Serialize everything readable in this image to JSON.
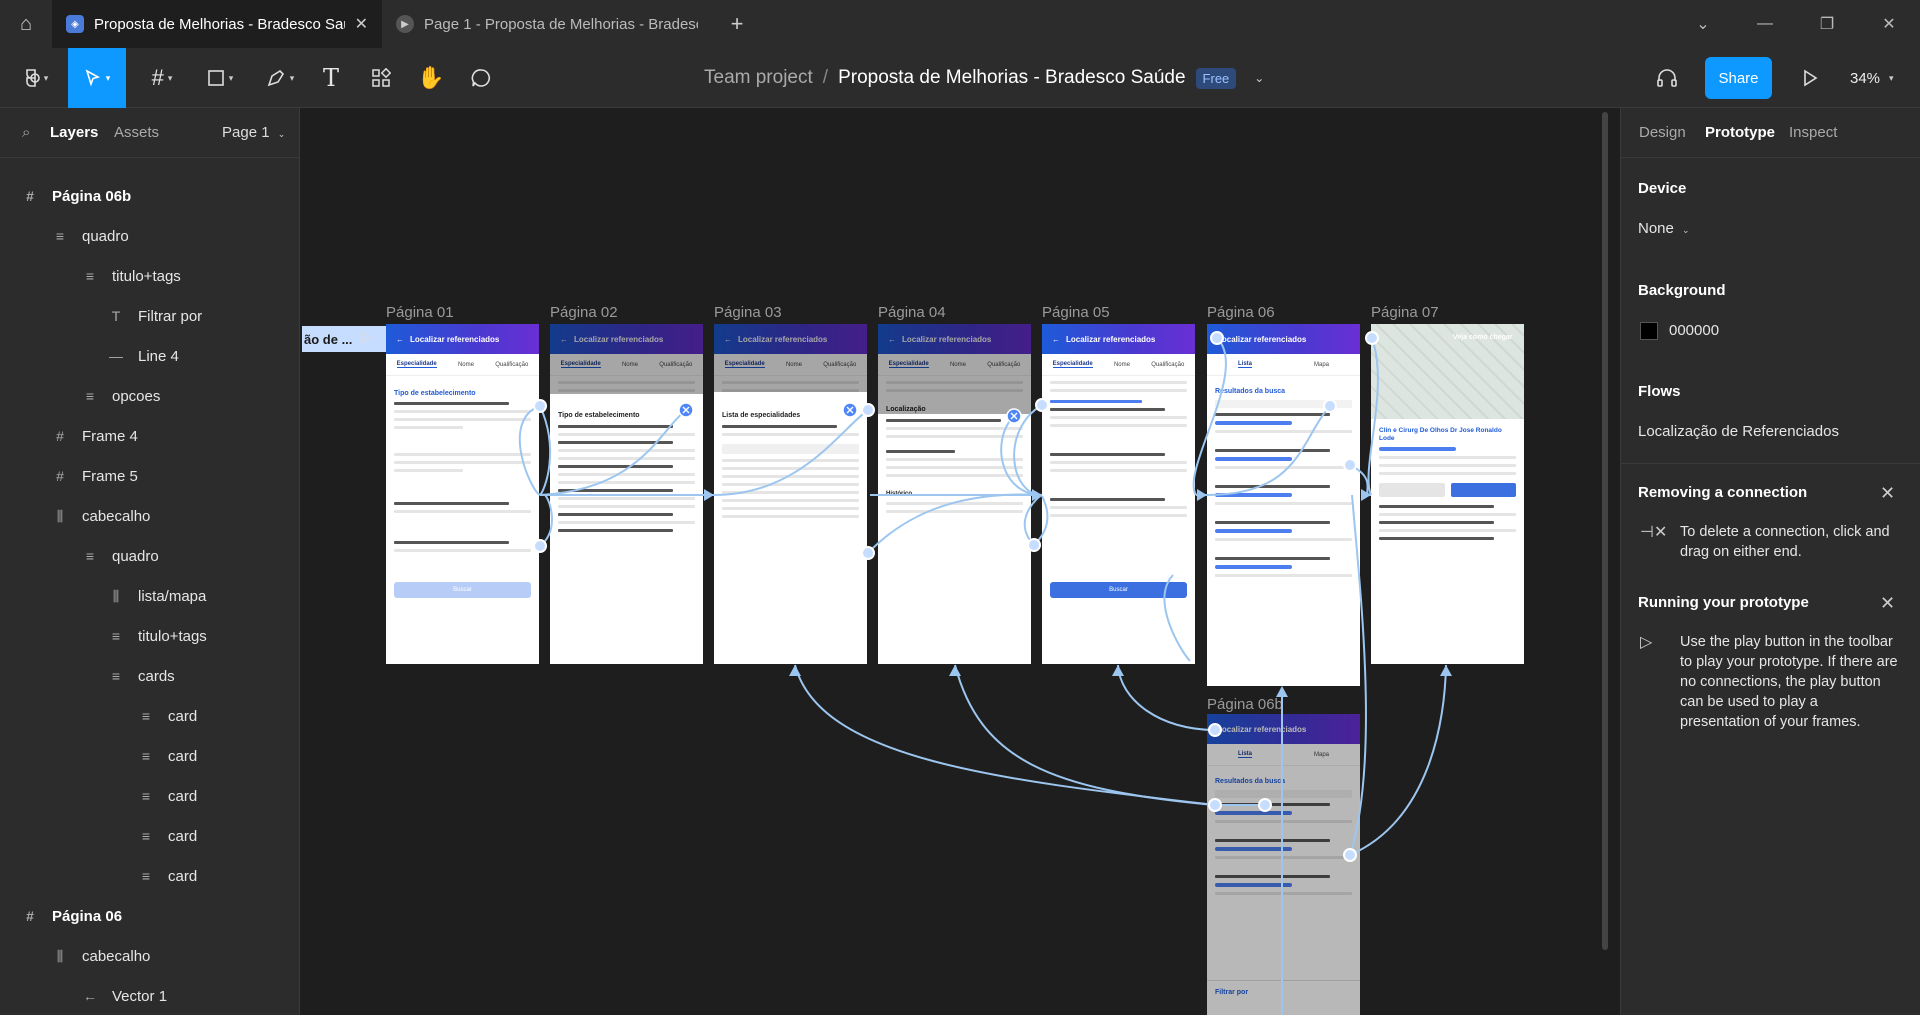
{
  "tabs": [
    {
      "label": "Proposta de Melhorias - Bradesco Saúde",
      "active": true
    },
    {
      "label": "Page 1 - Proposta de Melhorias - Bradesco",
      "active": false
    }
  ],
  "toolbar": {
    "team": "Team project",
    "separator": "/",
    "file_name": "Proposta de Melhorias - Bradesco Saúde",
    "plan_badge": "Free",
    "share_label": "Share",
    "zoom": "34%"
  },
  "left_panel": {
    "tab_layers": "Layers",
    "tab_assets": "Assets",
    "page": "Page 1",
    "layers": [
      {
        "name": "Página 06b",
        "icon": "frame-icon"
      },
      {
        "name": "quadro",
        "icon": "auto-layout-icon"
      },
      {
        "name": "titulo+tags",
        "icon": "auto-layout-icon"
      },
      {
        "name": "Filtrar por",
        "icon": "text-icon"
      },
      {
        "name": "Line 4",
        "icon": "line-icon"
      },
      {
        "name": "opcoes",
        "icon": "auto-layout-icon"
      },
      {
        "name": "Frame 4",
        "icon": "frame-icon"
      },
      {
        "name": "Frame 5",
        "icon": "frame-icon"
      },
      {
        "name": "cabecalho",
        "icon": "columns-icon"
      },
      {
        "name": "quadro",
        "icon": "auto-layout-icon"
      },
      {
        "name": "lista/mapa",
        "icon": "columns-icon"
      },
      {
        "name": "titulo+tags",
        "icon": "auto-layout-icon"
      },
      {
        "name": "cards",
        "icon": "auto-layout-icon"
      },
      {
        "name": "card",
        "icon": "auto-layout-icon"
      },
      {
        "name": "card",
        "icon": "auto-layout-icon"
      },
      {
        "name": "card",
        "icon": "auto-layout-icon"
      },
      {
        "name": "card",
        "icon": "auto-layout-icon"
      },
      {
        "name": "card",
        "icon": "auto-layout-icon"
      },
      {
        "name": "Página 06",
        "icon": "frame-icon"
      },
      {
        "name": "cabecalho",
        "icon": "columns-icon"
      },
      {
        "name": "Vector 1",
        "icon": "arrow-left-icon"
      }
    ]
  },
  "canvas": {
    "fragment_label": "ão de ...",
    "frames": [
      {
        "label": "Página 01",
        "header": "Localizar referenciados"
      },
      {
        "label": "Página 02",
        "header": "Localizar referenciados"
      },
      {
        "label": "Página 03",
        "header": "Localizar referenciados"
      },
      {
        "label": "Página 04",
        "header": "Localizar referenciados"
      },
      {
        "label": "Página 05",
        "header": "Localizar referenciados"
      },
      {
        "label": "Página 06",
        "header": "Localizar referenciados"
      },
      {
        "label": "Página 07",
        "header": "Veja como chegar"
      },
      {
        "label": "Página 06b",
        "header": "Localizar referenciados"
      }
    ],
    "screen_tabs": [
      "Especialidade",
      "Nome",
      "Qualificação"
    ],
    "list_tabs": [
      "Lista",
      "Mapa"
    ],
    "snippets": {
      "p01_section": "Tipo de estabelecimento",
      "p01_button": "Buscar",
      "p02_title": "Tipo de estabelecimento",
      "p03_title": "Lista de especialidades",
      "p04_title": "Localização",
      "p04_hist": "Histórico",
      "p05_button": "Buscar",
      "p06_results": "Resultados da busca",
      "p07_name": "Clin e Cirurg De Olhos Dr Jose Ronaldo Lode",
      "p06b_filter": "Filtrar por"
    }
  },
  "right_panel": {
    "tab_design": "Design",
    "tab_prototype": "Prototype",
    "tab_inspect": "Inspect",
    "device_heading": "Device",
    "device_value": "None",
    "background_heading": "Background",
    "background_hex": "000000",
    "flows_heading": "Flows",
    "flow_name": "Localização de Referenciados",
    "tip1_title": "Removing a connection",
    "tip1_text": "To delete a connection, click and drag on either end.",
    "tip2_title": "Running your prototype",
    "tip2_text": "Use the play button in the toolbar to play your prototype. If there are no connections, the play button can be used to play a presentation of your frames."
  },
  "help_label": "?",
  "colors": {
    "accent": "#0d99ff",
    "connection": "#9cc6ef",
    "panel": "#2c2c2c",
    "canvas": "#1e1e1e"
  }
}
